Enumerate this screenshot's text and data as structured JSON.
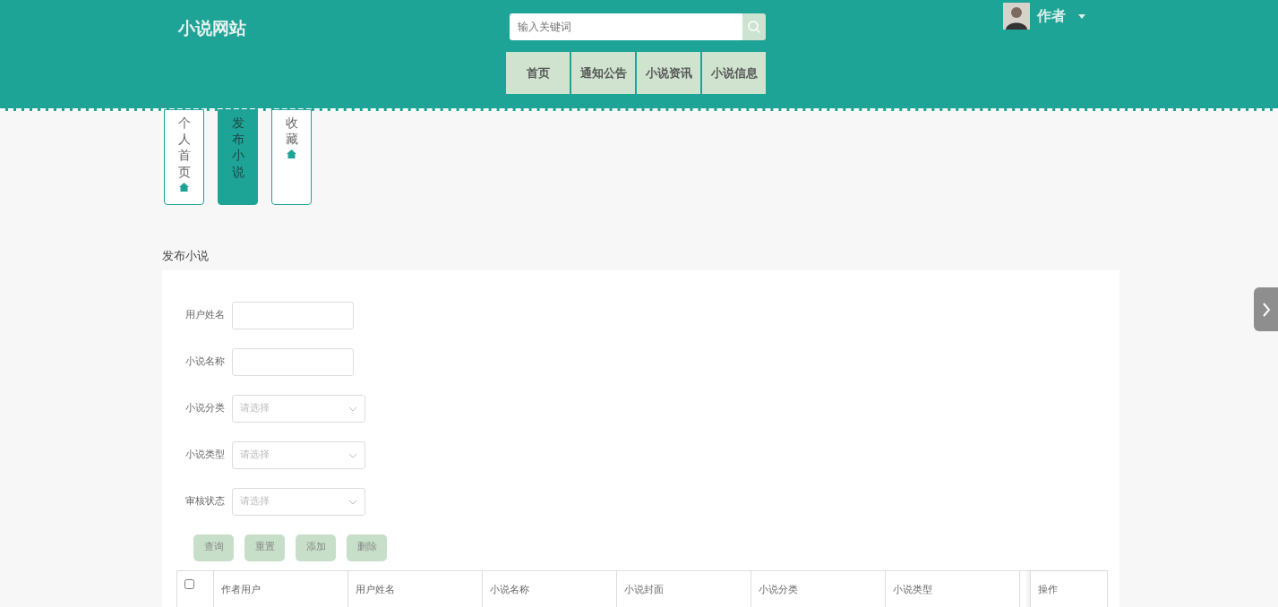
{
  "site_title": "小说网站",
  "search": {
    "placeholder": "输入关键词"
  },
  "nav": [
    {
      "label": "首页"
    },
    {
      "label": "通知公告"
    },
    {
      "label": "小说资讯"
    },
    {
      "label": "小说信息"
    }
  ],
  "user": {
    "name": "作者"
  },
  "side_tabs": [
    {
      "label": "个人首页",
      "selected": false
    },
    {
      "label": "发布小说",
      "selected": true
    },
    {
      "label": "收藏",
      "selected": false
    }
  ],
  "section_title": "发布小说",
  "filters": [
    {
      "kind": "input",
      "label": "用户姓名"
    },
    {
      "kind": "input",
      "label": "小说名称"
    },
    {
      "kind": "select",
      "label": "小说分类",
      "placeholder": "请选择"
    },
    {
      "kind": "select",
      "label": "小说类型",
      "placeholder": "请选择"
    },
    {
      "kind": "select",
      "label": "审核状态",
      "placeholder": "请选择"
    }
  ],
  "actions": [
    "查询",
    "重置",
    "添加",
    "删除"
  ],
  "table": {
    "select_all_checked": false,
    "columns": [
      "作者用户",
      "用户姓名",
      "小说名称",
      "小说封面",
      "小说分类",
      "小说类型",
      "操作"
    ]
  }
}
